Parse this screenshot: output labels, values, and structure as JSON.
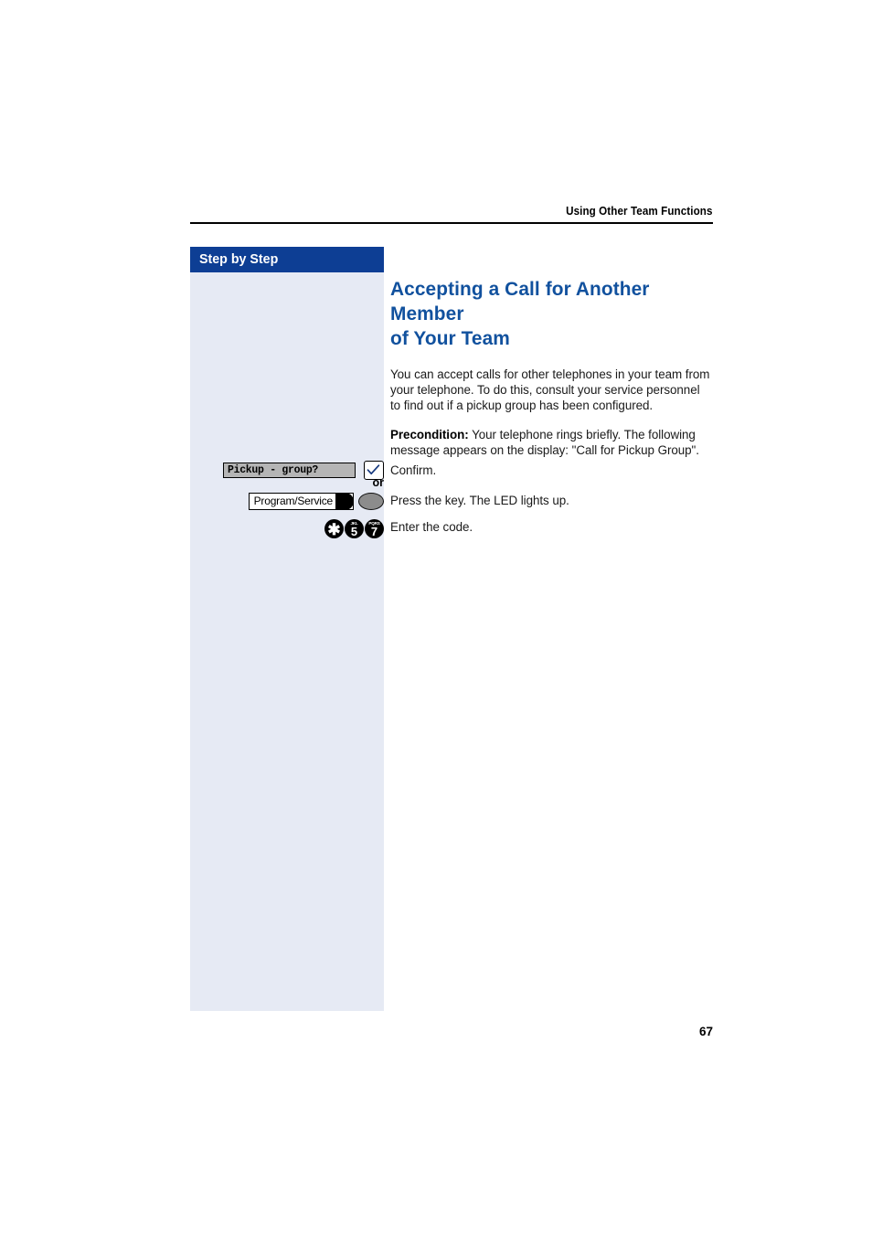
{
  "header": {
    "running_head": "Using Other Team Functions"
  },
  "sidebar": {
    "title": "Step by Step"
  },
  "content": {
    "title_line1": "Accepting a Call for Another Member",
    "title_line2": "of Your Team",
    "paragraph_1": "You can accept calls for other telephones in your team from your telephone. To do this, consult your service personnel to find out if a pickup group has been configured.",
    "paragraph_2_label": "Precondition:",
    "paragraph_2_text": " Your telephone rings briefly. The following message appears on the display: \"Call for Pickup Group\"."
  },
  "steps": [
    {
      "widget": "display-field",
      "display_text": "Pickup - group?",
      "key_icon": "checkmark-icon",
      "description": "Confirm."
    },
    {
      "widget": "or-separator",
      "label": "or"
    },
    {
      "widget": "function-key",
      "key_label": "Program/Service",
      "key_icon": "led-key-icon",
      "description": "Press the key. The LED lights up."
    },
    {
      "widget": "keypad",
      "keys": [
        {
          "digit": "✱",
          "letters": ""
        },
        {
          "digit": "5",
          "letters": "JKL"
        },
        {
          "digit": "7",
          "letters": "PQRS"
        }
      ],
      "description": "Enter the code."
    }
  ],
  "folio": {
    "page_number": "67"
  },
  "colors": {
    "brand_blue": "#0d3e94",
    "title_blue": "#11519e",
    "sidebar_bg": "#e6eaf4",
    "display_bg": "#b5b5b5",
    "led_gray": "#8c8c8c"
  }
}
